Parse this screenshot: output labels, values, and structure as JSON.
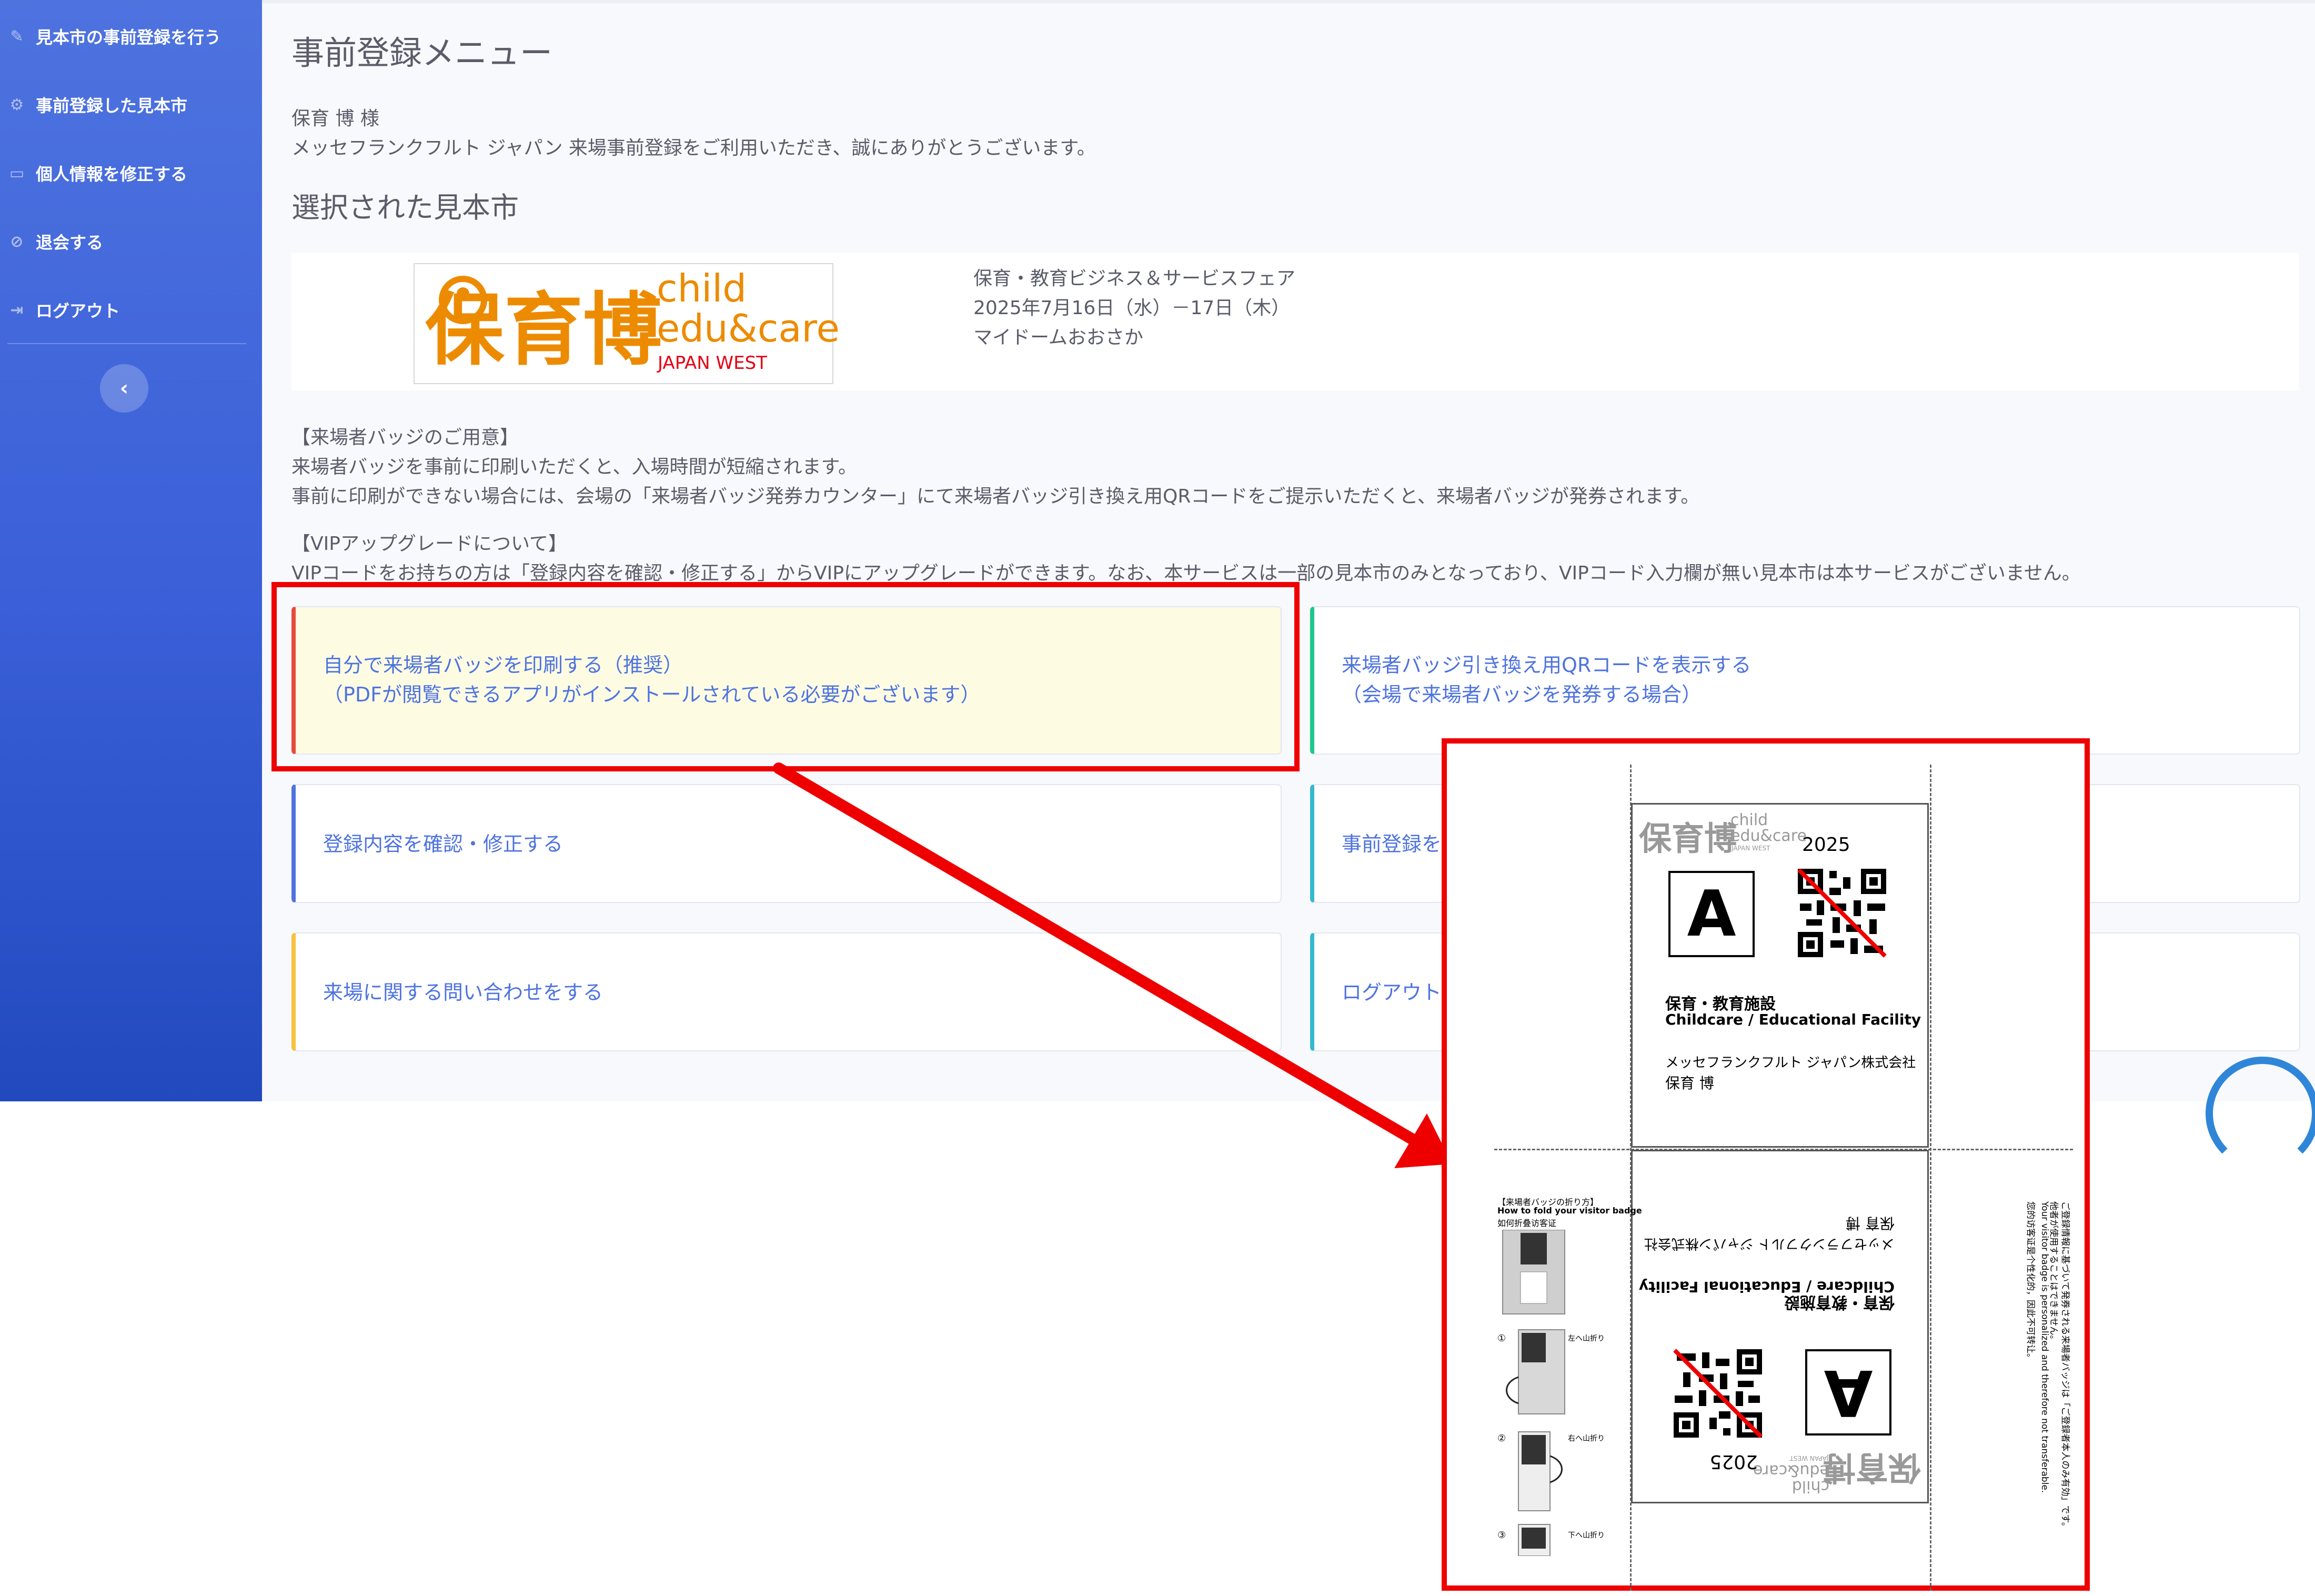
{
  "sidebar": {
    "items": [
      {
        "label": "見本市の事前登録を行う",
        "icon": "edit-icon"
      },
      {
        "label": "事前登録した見本市",
        "icon": "gear-icon"
      },
      {
        "label": "個人情報を修正する",
        "icon": "id-card-icon"
      },
      {
        "label": "退会する",
        "icon": "ban-icon"
      },
      {
        "label": "ログアウト",
        "icon": "sign-out-icon"
      }
    ],
    "toggle_label": "‹"
  },
  "page": {
    "title": "事前登録メニュー",
    "user_name": "保育 博 様",
    "greeting": "メッセフランクフルト ジャパン 来場事前登録をご利用いただき、誠にありがとうございます。",
    "selected_heading": "選択された見本市"
  },
  "fair": {
    "logo_main": "保育博",
    "logo_child": "child",
    "logo_educare": "edu&care",
    "logo_sub": "JAPAN WEST",
    "name": "保育・教育ビジネス＆サービスフェア",
    "date": "2025年7月16日（水）－17日（木）",
    "venue": "マイドームおおさか"
  },
  "notice": {
    "badge_title": "【来場者バッジのご用意】",
    "badge_line1": "来場者バッジを事前に印刷いただくと、入場時間が短縮されます。",
    "badge_line2": "事前に印刷ができない場合には、会場の「来場者バッジ発券カウンター」にて来場者バッジ引き換え用QRコードをご提示いただくと、来場者バッジが発券されます。",
    "vip_title": "【VIPアップグレードについて】",
    "vip_line": "VIPコードをお持ちの方は「登録内容を確認・修正する」からVIPにアップグレードができます。なお、本サービスは一部の見本市のみとなっており、VIPコード入力欄が無い見本市は本サービスがございません。"
  },
  "actions": {
    "print_badge_1": "自分で来場者バッジを印刷する（推奨）",
    "print_badge_2": "（PDFが閲覧できるアプリがインストールされている必要がございます）",
    "show_qr_1": "来場者バッジ引き換え用QRコードを表示する",
    "show_qr_2": "（会場で来場者バッジを発券する場合）",
    "edit_registration": "登録内容を確認・修正する",
    "cancel_registration": "事前登録を",
    "contact": "来場に関する問い合わせをする",
    "logout": "ログアウト"
  },
  "badge": {
    "logo_main": "保育博",
    "logo_child": "child",
    "logo_educare": "edu&care",
    "logo_sub": "JAPAN WEST",
    "year": "2025",
    "letter": "A",
    "category_jp": "保育・教育施設",
    "category_en": "Childcare / Educational Facility",
    "company": "メッセフランクフルト ジャパン株式会社",
    "name": "保育 博",
    "fold_title_jp": "【来場者バッジの折り方】",
    "fold_title_en": "How to fold your visitor badge",
    "fold_title_cn": "如何折叠访客证",
    "fold_step1": "左へ山折り",
    "fold_step2": "右へ山折り",
    "fold_step3": "下へ山折り",
    "step1": "①",
    "step2": "②",
    "step3": "③",
    "notice_jp": "ご登録情報に基づいて発券される来場者バッジは「ご登録者本人のみ有効」です。",
    "notice_jp2": "他者が使用することはできません。",
    "notice_en": "Your visitor badge is personalized and therefore not transferable.",
    "notice_cn": "您的访客证是个性化的，因此不可转让。"
  },
  "colors": {
    "primary": "#4e73df",
    "highlight_red": "#ee0000",
    "logo_orange": "#ed8b00",
    "logo_red": "#e60012"
  }
}
